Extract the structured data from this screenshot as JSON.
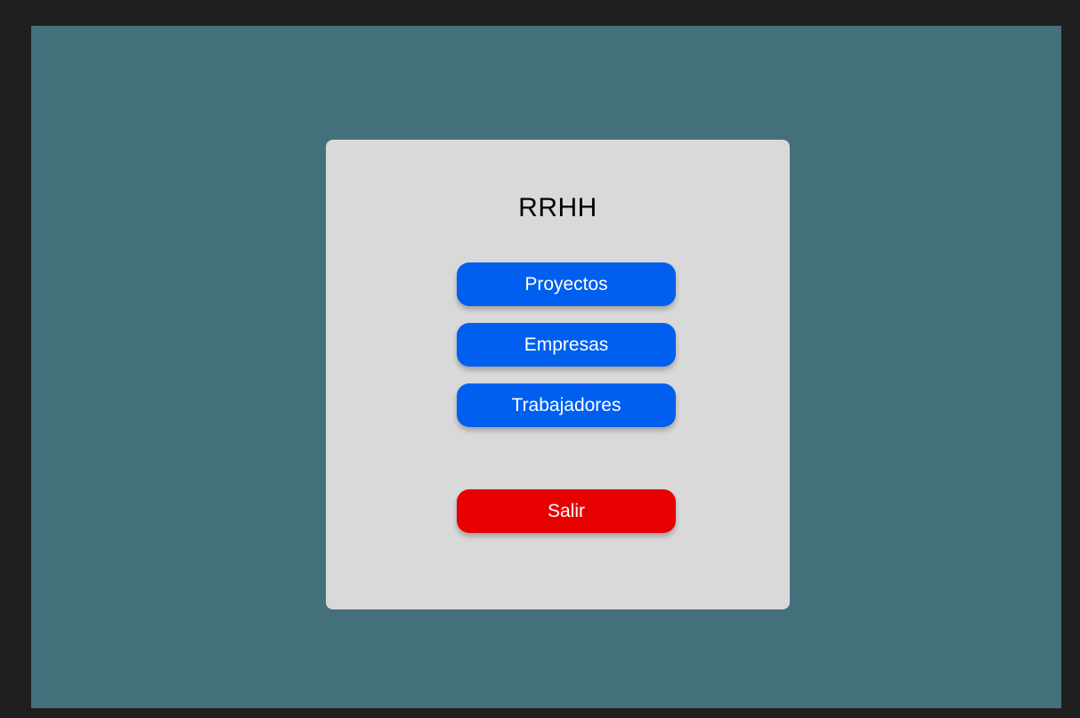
{
  "menu": {
    "title": "RRHH",
    "buttons": {
      "proyectos": "Proyectos",
      "empresas": "Empresas",
      "trabajadores": "Trabajadores",
      "salir": "Salir"
    }
  },
  "colors": {
    "frame": "#1f1f1f",
    "background": "#43707b",
    "card": "#d9d9d9",
    "primary": "#005fee",
    "danger": "#e80000",
    "button_text": "#ffffff"
  }
}
